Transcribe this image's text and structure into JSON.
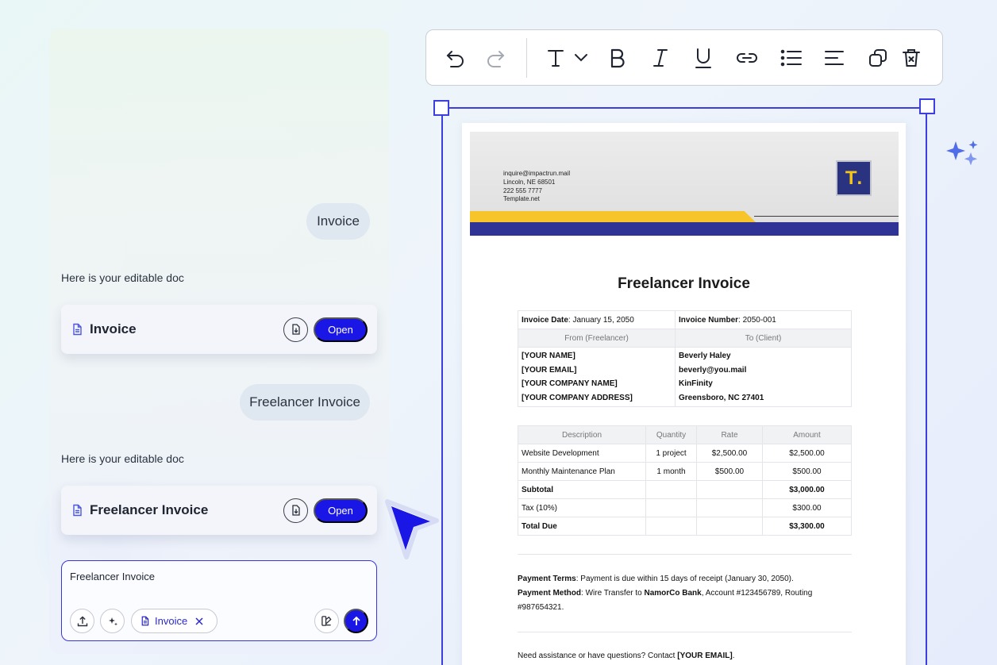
{
  "chat": {
    "messages": {
      "user_1": "Invoice",
      "bot_1": "Here is your editable doc",
      "user_2": "Freelancer Invoice",
      "bot_2": "Here is your editable doc"
    },
    "cards": [
      {
        "title": "Invoice",
        "open_label": "Open"
      },
      {
        "title": "Freelancer Invoice",
        "open_label": "Open"
      }
    ],
    "composer": {
      "value": "Freelancer Invoice",
      "chip_label": "Invoice"
    }
  },
  "toolbar": {
    "icons": [
      "undo-icon",
      "redo-icon",
      "text-style-icon",
      "bold-icon",
      "italic-icon",
      "underline-icon",
      "link-icon",
      "list-icon",
      "align-icon",
      "duplicate-icon",
      "delete-icon"
    ]
  },
  "document": {
    "header": {
      "email": "inquire@impactrun.mail",
      "address": "Lincoln, NE 68501",
      "phone": "222 555 7777",
      "site": "Template.net",
      "logo_letter": "T",
      "logo_dot": "."
    },
    "title": "Freelancer Invoice",
    "info": {
      "date_label": "Invoice Date",
      "date_value": "January 15, 2050",
      "number_label": "Invoice Number",
      "number_value": "2050-001",
      "from_header": "From (Freelancer)",
      "to_header": "To (Client)",
      "from_lines": [
        "[YOUR NAME]",
        "[YOUR EMAIL]",
        "[YOUR COMPANY NAME]",
        "[YOUR COMPANY ADDRESS]"
      ],
      "to_lines": [
        "Beverly Haley",
        "beverly@you.mail",
        "KinFinity",
        "Greensboro, NC 27401"
      ]
    },
    "items": {
      "headers": [
        "Description",
        "Quantity",
        "Rate",
        "Amount"
      ],
      "rows": [
        {
          "description": "Website Development",
          "quantity": "1 project",
          "rate": "$2,500.00",
          "amount": "$2,500.00"
        },
        {
          "description": "Monthly Maintenance Plan",
          "quantity": "1 month",
          "rate": "$500.00",
          "amount": "$500.00"
        }
      ],
      "subtotal_label": "Subtotal",
      "subtotal_value": "$3,000.00",
      "tax_label": "Tax (10%)",
      "tax_value": "$300.00",
      "total_label": "Total Due",
      "total_value": "$3,300.00"
    },
    "terms": {
      "payment_terms_label": "Payment Terms",
      "payment_terms_text": ": Payment is due within 15 days of receipt (January 30, 2050).",
      "payment_method_label": "Payment Method",
      "payment_method_text_1": ": Wire Transfer to ",
      "bank_name": "NamorCo Bank",
      "payment_method_text_2": ", Account #123456789, Routing #987654321."
    },
    "contact": {
      "text": "Need assistance or have questions? Contact ",
      "email": "[YOUR EMAIL]",
      "end": "."
    }
  },
  "colors": {
    "accent": "#1a16e6",
    "selection": "#3c3ee0",
    "doc_yellow": "#f7c52a",
    "doc_blue": "#2e3395"
  }
}
